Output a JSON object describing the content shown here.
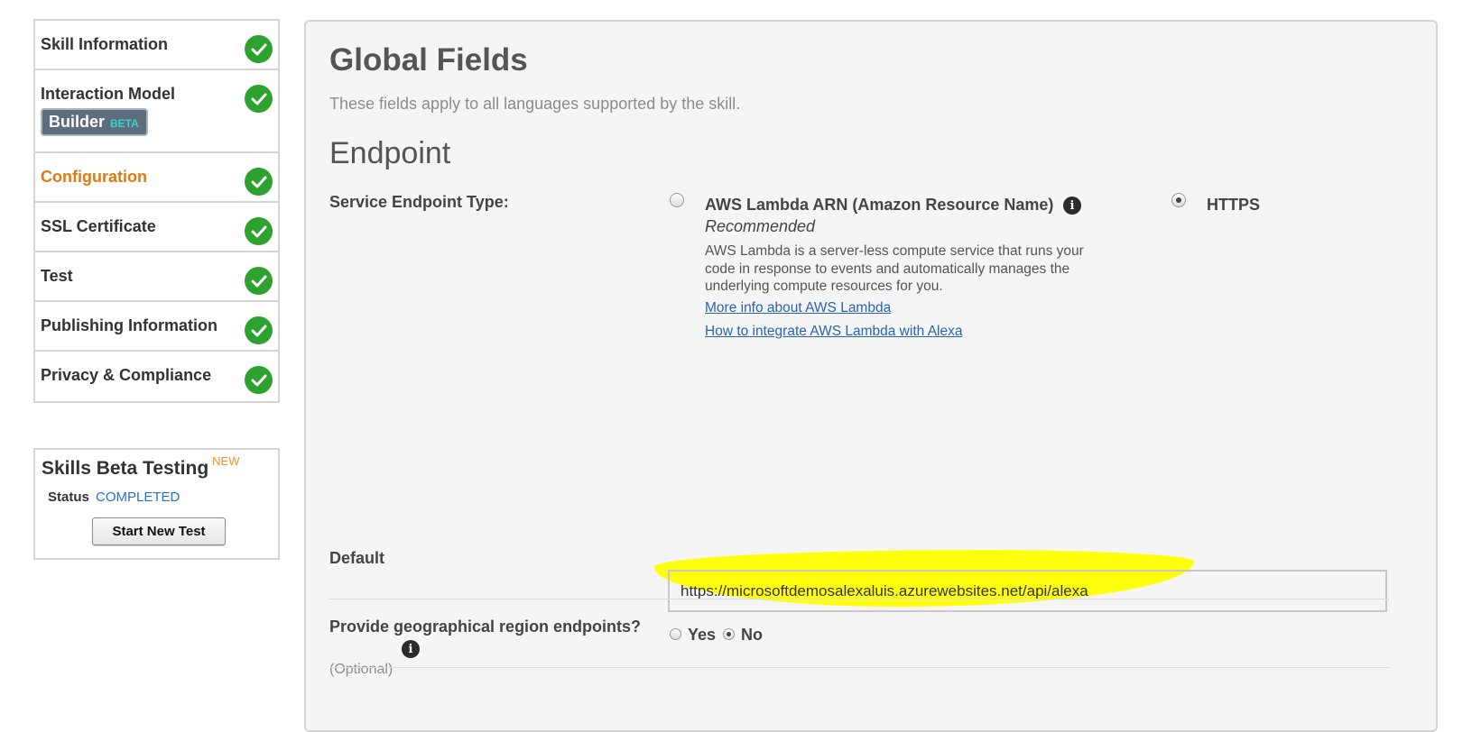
{
  "sidebar": {
    "items": [
      {
        "label": "Skill Information",
        "active": false
      },
      {
        "label": "Interaction Model",
        "active": false,
        "badge": {
          "text": "Builder",
          "tag": "BETA"
        }
      },
      {
        "label": "Configuration",
        "active": true
      },
      {
        "label": "SSL Certificate",
        "active": false
      },
      {
        "label": "Test",
        "active": false
      },
      {
        "label": "Publishing Information",
        "active": false
      },
      {
        "label": "Privacy & Compliance",
        "active": false
      }
    ],
    "check_icon": "check-circle-icon",
    "check_color": "#2ea22e",
    "active_color": "#e07a10"
  },
  "beta_testing": {
    "title": "Skills Beta Testing",
    "new_tag": "NEW",
    "status_label": "Status",
    "status_value": "COMPLETED",
    "button_label": "Start New Test"
  },
  "main": {
    "title": "Global Fields",
    "subtitle": "These fields apply to all languages supported by the skill.",
    "section_title": "Endpoint",
    "service_endpoint": {
      "label": "Service Endpoint Type:",
      "options": [
        {
          "title": "AWS Lambda ARN (Amazon Resource Name)",
          "selected": false,
          "recommended": "Recommended",
          "description": "AWS Lambda is a server-less compute service that runs your code in response to events and automatically manages the underlying compute resources for you.",
          "links": [
            "More info about AWS Lambda",
            "How to integrate AWS Lambda with Alexa"
          ]
        },
        {
          "title": "HTTPS",
          "selected": true
        }
      ]
    },
    "default": {
      "label": "Default",
      "value": "https://microsoftdemosalexaluis.azurewebsites.net/api/alexa",
      "highlight_color": "#ffff00"
    },
    "geo_region": {
      "label": "Provide geographical region endpoints?",
      "optional": "(Optional)",
      "options": [
        {
          "label": "Yes",
          "selected": false
        },
        {
          "label": "No",
          "selected": true
        }
      ]
    }
  }
}
